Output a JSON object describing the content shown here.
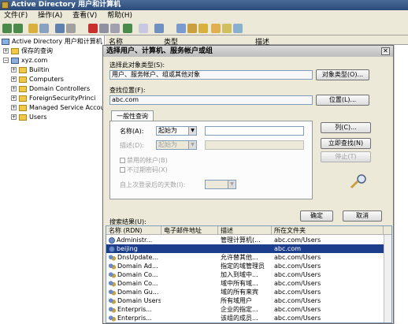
{
  "window": {
    "title": "Active Directory 用户和计算机"
  },
  "menu": {
    "items": [
      "文件(F)",
      "操作(A)",
      "查看(V)",
      "帮助(H)"
    ]
  },
  "tree": {
    "root": "Active Directory 用户和计算机",
    "saved_queries": "保存的查询",
    "domain": "xyz.com",
    "children": [
      "Builtin",
      "Computers",
      "Domain Controllers",
      "ForeignSecurityPrinci",
      "Managed Service Accou",
      "Users"
    ]
  },
  "list_header": {
    "name": "名称",
    "type": "类型",
    "desc": "描述"
  },
  "dialog": {
    "title": "选择用户、计算机、服务帐户或组",
    "object_type_label": "选择此对象类型(S):",
    "object_type_value": "用户、服务帐户、组或其他对象",
    "object_type_button": "对象类型(O)...",
    "location_label": "查找位置(F):",
    "location_value": "abc.com",
    "location_button": "位置(L)...",
    "tab_label": "一般性查询",
    "name_label": "名称(A):",
    "name_combo": "起始为",
    "desc_label": "描述(D):",
    "desc_combo": "起始为",
    "disabled_accounts": "禁用的帐户(B)",
    "no_expire_password": "不过期密码(X)",
    "days_since_logon": "自上次登录后的天数(I):",
    "columns_button": "列(C)...",
    "find_now_button": "立即查找(N)",
    "stop_button": "停止(T)",
    "ok_button": "确定",
    "cancel_button": "取消",
    "results_label": "搜索结果(U):",
    "results_columns": [
      "名称 (RDN)",
      "电子邮件地址",
      "描述",
      "所在文件夹"
    ],
    "results_rows": [
      {
        "name": "Administr...",
        "email": "",
        "desc": "管理计算机(...",
        "folder": "abc.com/Users",
        "icon": "user-icon",
        "selected": false
      },
      {
        "name": "beijing",
        "email": "",
        "desc": "",
        "folder": "abc.com",
        "icon": "user-icon",
        "selected": true
      },
      {
        "name": "DnsUpdate...",
        "email": "",
        "desc": "允许替其他...",
        "folder": "abc.com/Users",
        "icon": "group-icon",
        "selected": false
      },
      {
        "name": "Domain Ad...",
        "email": "",
        "desc": "指定的域管理员",
        "folder": "abc.com/Users",
        "icon": "group-icon",
        "selected": false
      },
      {
        "name": "Domain Co...",
        "email": "",
        "desc": "加入到域中...",
        "folder": "abc.com/Users",
        "icon": "group-icon",
        "selected": false
      },
      {
        "name": "Domain Co...",
        "email": "",
        "desc": "域中所有域...",
        "folder": "abc.com/Users",
        "icon": "group-icon",
        "selected": false
      },
      {
        "name": "Domain Gu...",
        "email": "",
        "desc": "域的所有来宾",
        "folder": "abc.com/Users",
        "icon": "group-icon",
        "selected": false
      },
      {
        "name": "Domain Users",
        "email": "",
        "desc": "所有域用户",
        "folder": "abc.com/Users",
        "icon": "group-icon",
        "selected": false
      },
      {
        "name": "Enterpris...",
        "email": "",
        "desc": "企业的指定...",
        "folder": "abc.com/Users",
        "icon": "group-icon",
        "selected": false
      },
      {
        "name": "Enterpris...",
        "email": "",
        "desc": "该组的成员...",
        "folder": "abc.com/Users",
        "icon": "group-icon",
        "selected": false
      }
    ]
  },
  "colors": {
    "selection": "#1c3c8c",
    "dialog_bg": "#ece9d8",
    "titlebar": "#2a4a7a"
  }
}
